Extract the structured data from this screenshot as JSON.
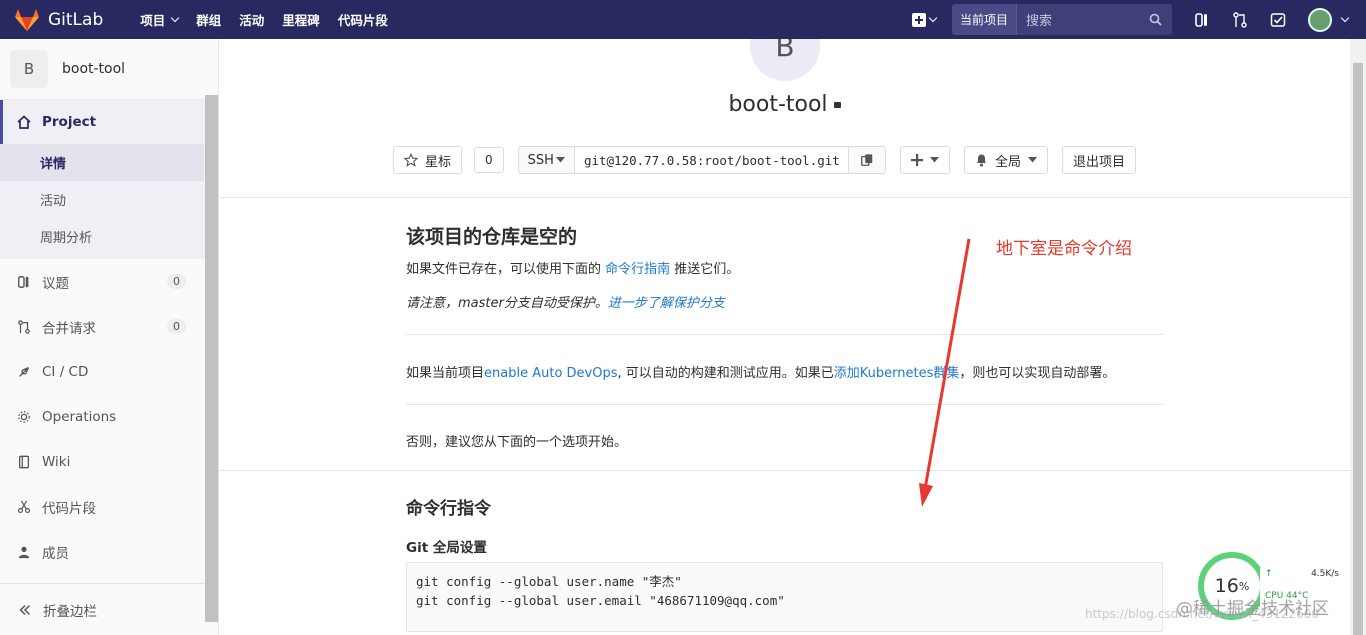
{
  "topbar": {
    "brand": "GitLab",
    "nav": [
      "项目",
      "群组",
      "活动",
      "里程碑",
      "代码片段"
    ],
    "scope_label": "当前项目",
    "search_placeholder": "搜索"
  },
  "sidebar": {
    "project_initial": "B",
    "project_name": "boot-tool",
    "project_label": "Project",
    "project_sub": [
      "详情",
      "活动",
      "周期分析"
    ],
    "items": [
      {
        "label": "议题",
        "badge": "0"
      },
      {
        "label": "合并请求",
        "badge": "0"
      },
      {
        "label": "CI / CD"
      },
      {
        "label": "Operations"
      },
      {
        "label": "Wiki"
      },
      {
        "label": "代码片段"
      },
      {
        "label": "成员"
      }
    ],
    "collapse_label": "折叠边栏"
  },
  "project": {
    "initial": "B",
    "title": "boot-tool",
    "star_label": "星标",
    "star_count": "0",
    "clone_protocol": "SSH",
    "clone_url": "git@120.77.0.58:root/boot-tool.git",
    "notify_label": "全局",
    "leave_label": "退出项目"
  },
  "empty_repo": {
    "heading": "该项目的仓库是空的",
    "line1_pre": "如果文件已存在，可以使用下面的 ",
    "line1_link": "命令行指南",
    "line1_post": " 推送它们。",
    "line2_pre": "请注意，master分支自动受保护。",
    "line2_link": "进一步了解保护分支",
    "line3_pre": "如果当前项目",
    "line3_link1": "enable Auto DevOps",
    "line3_mid": ", 可以自动的构建和测试应用。如果已",
    "line3_link2": "添加Kubernetes群集",
    "line3_post": "，则也可以实现自动部署。",
    "line4": "否则，建议您从下面的一个选项开始。"
  },
  "cli": {
    "heading": "命令行指令",
    "git_global": "Git 全局设置",
    "code": "git config --global user.name \"李杰\"\ngit config --global user.email \"468671109@qq.com\""
  },
  "annotation": "地下室是命令介绍",
  "monitor": {
    "percent": "16",
    "unit": "%",
    "net": "4.5K/s",
    "cpu": "CPU 44°C"
  },
  "watermark": {
    "text1": "@稀土掘金技术社区",
    "text2": "https://blog.csdn.net/weixin_43122600"
  }
}
